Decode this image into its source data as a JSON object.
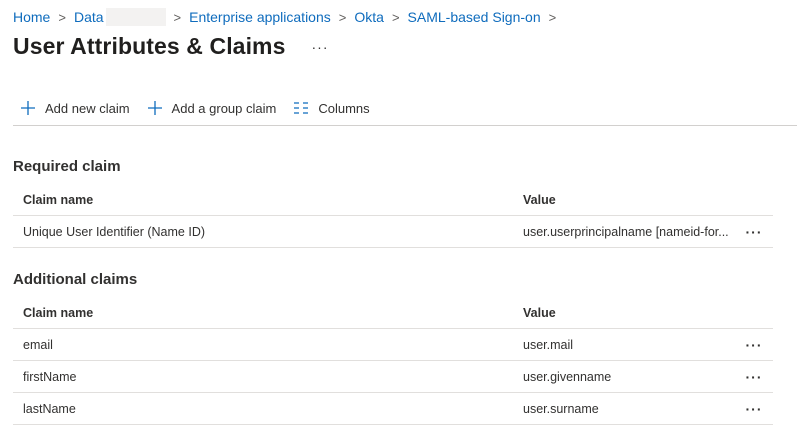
{
  "breadcrumb": {
    "items": [
      "Home",
      "Data",
      "Enterprise applications",
      "Okta",
      "SAML-based Sign-on"
    ],
    "separator": ">"
  },
  "page": {
    "title": "User Attributes & Claims",
    "more": "···"
  },
  "toolbar": {
    "add_new_claim": "Add new claim",
    "add_group_claim": "Add a group claim",
    "columns": "Columns"
  },
  "required": {
    "title": "Required claim",
    "col_name": "Claim name",
    "col_value": "Value",
    "rows": [
      {
        "name": "Unique User Identifier (Name ID)",
        "value": "user.userprincipalname [nameid-for...",
        "more": "···"
      }
    ]
  },
  "additional": {
    "title": "Additional claims",
    "col_name": "Claim name",
    "col_value": "Value",
    "rows": [
      {
        "name": "email",
        "value": "user.mail",
        "more": "···"
      },
      {
        "name": "firstName",
        "value": "user.givenname",
        "more": "···"
      },
      {
        "name": "lastName",
        "value": "user.surname",
        "more": "···"
      }
    ]
  },
  "colors": {
    "link": "#0f6cbd",
    "text": "#323130",
    "divider": "#e1dfdd"
  },
  "icons": {
    "add_new_claim": "plus-icon",
    "add_group_claim": "plus-icon",
    "columns": "columns-icon"
  }
}
